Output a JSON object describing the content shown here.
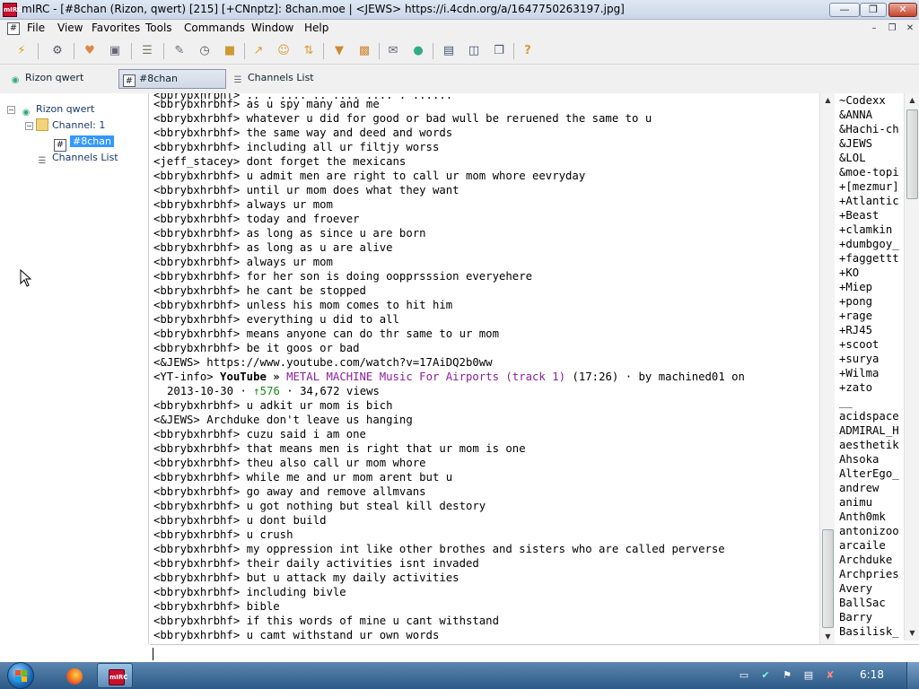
{
  "window": {
    "title": "mIRC - [#8chan (Rizon, qwert) [215] [+CNnptz]: 8chan.moe | <JEWS> https://i.4cdn.org/a/1647750263197.jpg]",
    "app_icon_text": "mIRC"
  },
  "menu": {
    "items": [
      "File",
      "View",
      "Favorites",
      "Tools",
      "Commands",
      "Window",
      "Help"
    ],
    "mdi_icon": "#"
  },
  "toolbar": {
    "icons": [
      "connect-icon",
      "options-icon",
      "favorites-icon",
      "address-book-icon",
      "channels-list-icon",
      "scripts-editor-icon",
      "timer-icon",
      "colors-icon",
      "send-file-icon",
      "chat-icon",
      "dcc-icon",
      "received-files-icon",
      "logs-icon",
      "notify-icon",
      "url-list-icon",
      "tile-horizontal-icon",
      "tile-vertical-icon",
      "cascade-icon",
      "help-icon"
    ]
  },
  "switchbar": {
    "network": "Rizon qwert",
    "channel": "#8chan",
    "channels_list": "Channels List"
  },
  "tree": {
    "network": "Rizon qwert",
    "channel_group": "Channel: 1",
    "channel": "#8chan",
    "channels_list": "Channels List"
  },
  "chat": {
    "lines": [
      {
        "nick": "<bbrybxhrbhf>",
        "text": "as u spy many and me"
      },
      {
        "nick": "<bbrybxhrbhf>",
        "text": "whatever u did for good or bad wull be reruened the same to u"
      },
      {
        "nick": "<bbrybxhrbhf>",
        "text": "the same way and deed and words"
      },
      {
        "nick": "<bbrybxhrbhf>",
        "text": "including all ur filtjy worss"
      },
      {
        "nick": "<jeff_stacey>",
        "text": "dont forget the mexicans"
      },
      {
        "nick": "<bbrybxhrbhf>",
        "text": "u admit men are right to call ur mom whore eevryday"
      },
      {
        "nick": "<bbrybxhrbhf>",
        "text": "until ur mom does what they want"
      },
      {
        "nick": "<bbrybxhrbhf>",
        "text": "always ur mom"
      },
      {
        "nick": "<bbrybxhrbhf>",
        "text": "today and froever"
      },
      {
        "nick": "<bbrybxhrbhf>",
        "text": "as long as since u are born"
      },
      {
        "nick": "<bbrybxhrbhf>",
        "text": "as long as u are alive"
      },
      {
        "nick": "<bbrybxhrbhf>",
        "text": "always ur mom"
      },
      {
        "nick": "<bbrybxhrbhf>",
        "text": "for her son is doing oopprsssion everyehere"
      },
      {
        "nick": "<bbrybxhrbhf>",
        "text": "he cant be stopped"
      },
      {
        "nick": "<bbrybxhrbhf>",
        "text": "unless his mom comes to hit him"
      },
      {
        "nick": "<bbrybxhrbhf>",
        "text": "everything u did to all"
      },
      {
        "nick": "<bbrybxhrbhf>",
        "text": "means anyone can do thr same to ur mom"
      },
      {
        "nick": "<bbrybxhrbhf>",
        "text": "be it goos or bad"
      },
      {
        "nick": "<&JEWS>",
        "text": "https://www.youtube.com/watch?v=17AiDQ2b0ww"
      }
    ],
    "yt_info": {
      "nick": "<YT-info>",
      "brand": "YouTube",
      "sep": "»",
      "video_title": "METAL MACHINE Music For Airports (track 1)",
      "duration": "(17:26)",
      "by": "· by machined01 on",
      "date": "2013-10-30",
      "dot1": "·",
      "likes": "↑576",
      "views": "· 34,672 views"
    },
    "lines2": [
      {
        "nick": "<bbrybxhrbhf>",
        "text": "u adkit ur mom is bich"
      },
      {
        "nick": "<&JEWS>",
        "text": "Archduke don't leave us hanging"
      },
      {
        "nick": "<bbrybxhrbhf>",
        "text": "cuzu said i am one"
      },
      {
        "nick": "<bbrybxhrbhf>",
        "text": "that means men is right that ur mom is one"
      },
      {
        "nick": "<bbrybxhrbhf>",
        "text": "theu also call ur mom whore"
      },
      {
        "nick": "<bbrybxhrbhf>",
        "text": "while me and ur mom arent but u"
      },
      {
        "nick": "<bbrybxhrbhf>",
        "text": "go away and remove allmvans"
      },
      {
        "nick": "<bbrybxhrbhf>",
        "text": "u got nothing but steal kill destory"
      },
      {
        "nick": "<bbrybxhrbhf>",
        "text": "u dont build"
      },
      {
        "nick": "<bbrybxhrbhf>",
        "text": "u crush"
      },
      {
        "nick": "<bbrybxhrbhf>",
        "text": "my oppression int like other brothes and sisters who are called perverse"
      },
      {
        "nick": "<bbrybxhrbhf>",
        "text": "their daily activities isnt invaded"
      },
      {
        "nick": "<bbrybxhrbhf>",
        "text": "but u attack my daily activities"
      },
      {
        "nick": "<bbrybxhrbhf>",
        "text": "including bivle"
      },
      {
        "nick": "<bbrybxhrbhf>",
        "text": "bible"
      },
      {
        "nick": "<bbrybxhrbhf>",
        "text": "if this words of mine u cant withstand"
      },
      {
        "nick": "<bbrybxhrbhf>",
        "text": "u camt withstand ur own words"
      }
    ]
  },
  "nicklist": {
    "nicks": [
      "~Codexx",
      "&ANNA",
      "&Hachi-ch",
      "&JEWS",
      "&LOL",
      "&moe-topi",
      "+[mezmur]",
      "+Atlantic",
      "+Beast",
      "+clamkin",
      "+dumbgoy_",
      "+faggettt",
      "+KO",
      "+Miep",
      "+pong",
      "+rage",
      "+RJ45",
      "+scoot",
      "+surya",
      "+Wilma",
      "+zato",
      "__",
      "acidspace",
      "ADMIRAL_H",
      "aesthetik",
      "Ahsoka",
      "AlterEgo_",
      "andrew",
      "animu",
      "Anth0mk",
      "antonizoo",
      "arcaile",
      "Archduke",
      "Archpries",
      "Avery",
      "BallSac",
      "Barry",
      "Basilisk_"
    ]
  },
  "taskbar": {
    "clock": "6:18"
  }
}
